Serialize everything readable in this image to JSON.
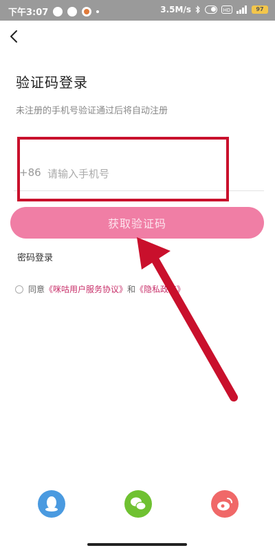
{
  "status_bar": {
    "time": "下午3:07",
    "speed": "3.5M/s",
    "network": "4G",
    "hd": "HD",
    "battery": "97"
  },
  "header": {
    "title": "验证码登录",
    "subtitle": "未注册的手机号验证通过后将自动注册"
  },
  "phone": {
    "country_code": "+86",
    "placeholder": "请输入手机号",
    "value": ""
  },
  "buttons": {
    "get_code": "获取验证码",
    "password_login": "密码登录"
  },
  "agreement": {
    "prefix": "同意",
    "service_link": "《咪咕用户服务协议》",
    "conjunction": "和",
    "privacy_link": "《隐私政策》",
    "checked": false
  },
  "social_logins": [
    {
      "name": "qq-icon",
      "color": "#4a9ae0"
    },
    {
      "name": "wechat-icon",
      "color": "#6fc131"
    },
    {
      "name": "weibo-icon",
      "color": "#f06868"
    }
  ],
  "colors": {
    "accent": "#f07ea5",
    "link": "#c8306a",
    "annotation": "#c9102c"
  }
}
